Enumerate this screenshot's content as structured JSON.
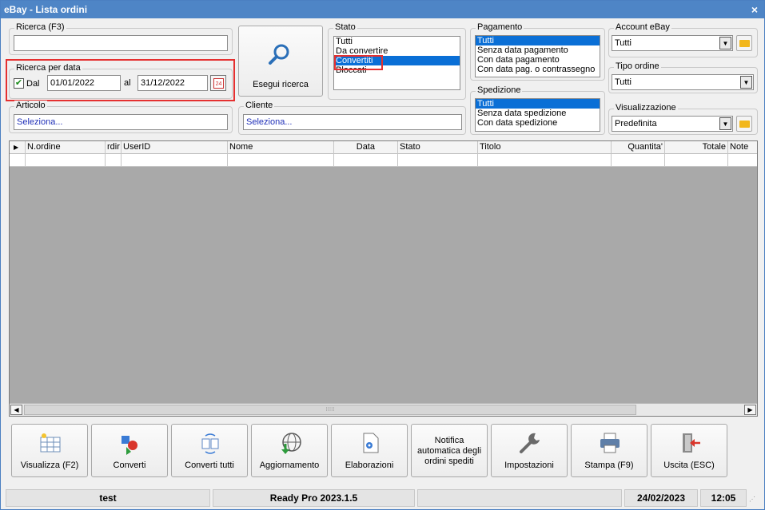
{
  "window": {
    "title": "eBay - Lista ordini",
    "close": "×"
  },
  "ricerca": {
    "legend": "Ricerca (F3)",
    "value": ""
  },
  "ricerca_data": {
    "legend": "Ricerca per data",
    "dal_label": "Dal",
    "dal_checked": true,
    "dal_value": "01/01/2022",
    "al_label": "al",
    "al_value": "31/12/2022",
    "cal_day": "24"
  },
  "articolo": {
    "legend": "Articolo",
    "value": "Seleziona..."
  },
  "cliente": {
    "legend": "Cliente",
    "value": "Seleziona..."
  },
  "esegui": {
    "label": "Esegui ricerca"
  },
  "stato": {
    "legend": "Stato",
    "items": [
      "Tutti",
      "Da convertire",
      "Convertiti",
      "Bloccati"
    ],
    "selected": "Convertiti"
  },
  "pagamento": {
    "legend": "Pagamento",
    "items": [
      "Tutti",
      "Senza data pagamento",
      "Con data pagamento",
      "Con data pag. o contrassegno"
    ],
    "selected": "Tutti"
  },
  "spedizione": {
    "legend": "Spedizione",
    "items": [
      "Tutti",
      "Senza data spedizione",
      "Con data spedizione"
    ],
    "selected": "Tutti"
  },
  "account": {
    "legend": "Account eBay",
    "value": "Tutti"
  },
  "tipo_ordine": {
    "legend": "Tipo ordine",
    "value": "Tutti"
  },
  "visualizzazione": {
    "legend": "Visualizzazione",
    "value": "Predefinita"
  },
  "grid": {
    "columns": [
      "N.ordine",
      "rdir",
      "UserID",
      "Nome",
      "Data",
      "Stato",
      "Titolo",
      "Quantita'",
      "Totale",
      "Note"
    ]
  },
  "toolbar": {
    "visualizza": "Visualizza (F2)",
    "converti": "Converti",
    "converti_tutti": "Converti tutti",
    "aggiornamento": "Aggiornamento",
    "elaborazioni": "Elaborazioni",
    "notifica": "Notifica automatica degli ordini spediti",
    "impostazioni": "Impostazioni",
    "stampa": "Stampa (F9)",
    "uscita": "Uscita (ESC)"
  },
  "statusbar": {
    "user": "test",
    "version": "Ready Pro 2023.1.5",
    "empty": "",
    "date": "24/02/2023",
    "time": "12:05"
  },
  "colors": {
    "title_bar": "#4e85c6",
    "selection": "#0a6fd6",
    "highlight": "#e53030"
  }
}
